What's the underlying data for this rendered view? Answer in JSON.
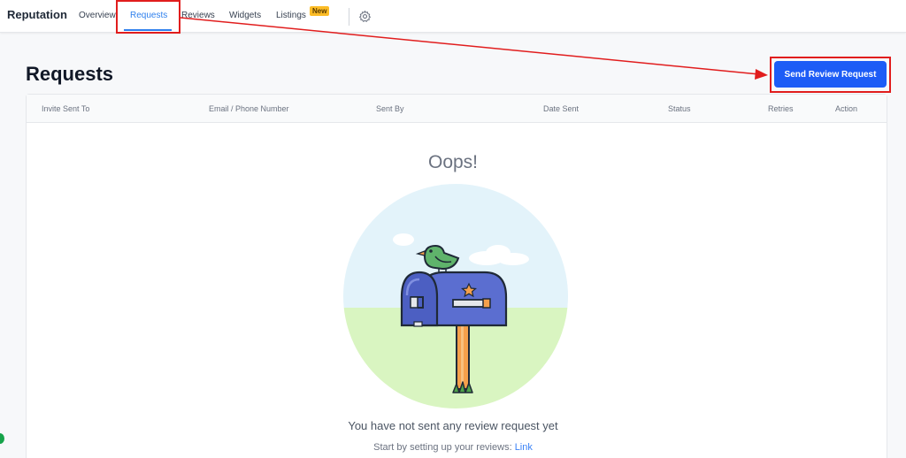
{
  "topbar": {
    "brand": "Reputation",
    "nav": [
      "Overview",
      "Requests",
      "Reviews",
      "Widgets",
      "Listings"
    ],
    "new_badge": "New",
    "active_tab": "Requests",
    "accent_color": "#2f80ed"
  },
  "page": {
    "title": "Requests",
    "send_button": "Send Review Request",
    "button_color": "#1d5cf6"
  },
  "table": {
    "columns": [
      "Invite Sent To",
      "Email / Phone Number",
      "Sent By",
      "Date Sent",
      "Status",
      "Retries",
      "Action"
    ]
  },
  "empty_state": {
    "heading": "Oops!",
    "message": "You have not sent any review request yet",
    "hint": "Start by setting up your reviews:",
    "link": "Link",
    "illustration": "mailbox-bird-illustration"
  },
  "annotation": {
    "highlight_color": "#e11d1d"
  }
}
